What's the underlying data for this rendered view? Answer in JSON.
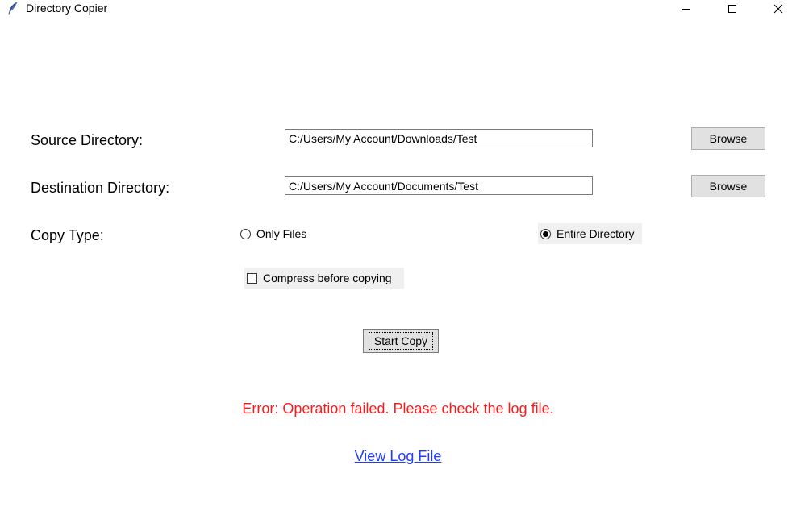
{
  "window": {
    "title": "Directory Copier",
    "icon": "feather-icon"
  },
  "labels": {
    "source": "Source Directory:",
    "destination": "Destination Directory:",
    "copy_type": "Copy Type:"
  },
  "inputs": {
    "source_value": "C:/Users/My Account/Downloads/Test",
    "destination_value": "C:/Users/My Account/Documents/Test"
  },
  "buttons": {
    "browse_source": "Browse",
    "browse_destination": "Browse",
    "start_copy": "Start Copy"
  },
  "copy_type_options": {
    "only_files": "Only Files",
    "entire_directory": "Entire Directory",
    "selected": "entire_directory"
  },
  "compress": {
    "label": "Compress before copying",
    "checked": false
  },
  "status": {
    "error": "Error: Operation failed. Please check the log file.",
    "error_color": "#ff1a1a"
  },
  "links": {
    "view_log": "View Log File",
    "link_color": "#1f3cff"
  }
}
